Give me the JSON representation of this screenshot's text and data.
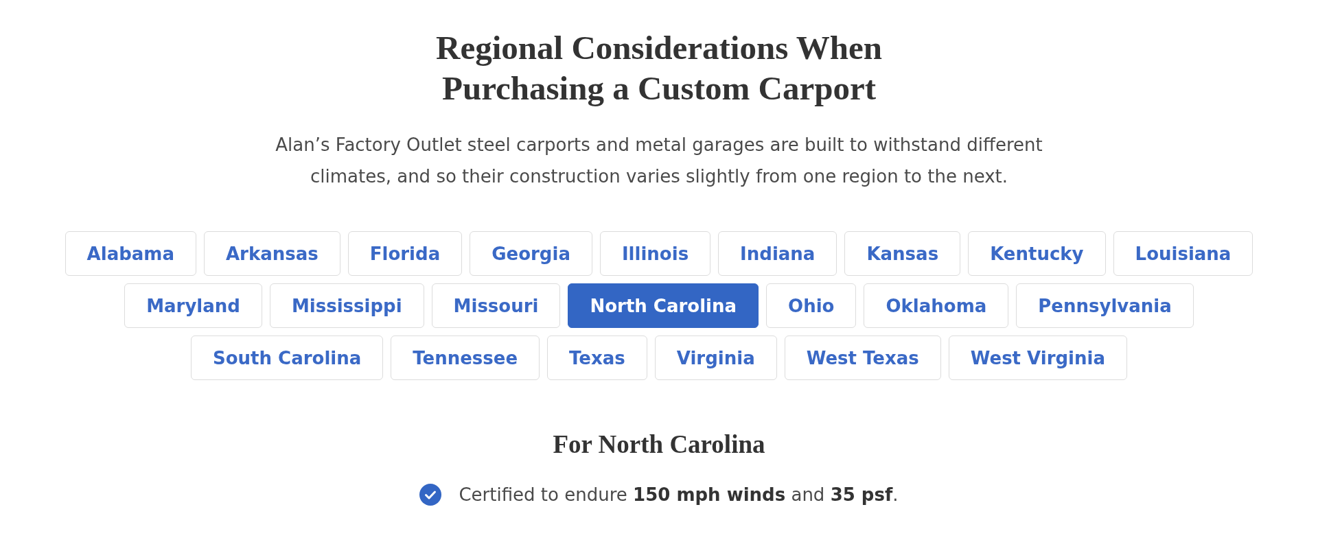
{
  "heading": {
    "title": "Regional Considerations When Purchasing a Custom Carport",
    "intro": "Alan’s Factory Outlet steel carports and metal garages are built to withstand different climates, and so their construction varies slightly from one region to the next."
  },
  "region_tabs": [
    {
      "label": "Alabama",
      "selected": false
    },
    {
      "label": "Arkansas",
      "selected": false
    },
    {
      "label": "Florida",
      "selected": false
    },
    {
      "label": "Georgia",
      "selected": false
    },
    {
      "label": "Illinois",
      "selected": false
    },
    {
      "label": "Indiana",
      "selected": false
    },
    {
      "label": "Kansas",
      "selected": false
    },
    {
      "label": "Kentucky",
      "selected": false
    },
    {
      "label": "Louisiana",
      "selected": false
    },
    {
      "label": "Maryland",
      "selected": false
    },
    {
      "label": "Mississippi",
      "selected": false
    },
    {
      "label": "Missouri",
      "selected": false
    },
    {
      "label": "North Carolina",
      "selected": true
    },
    {
      "label": "Ohio",
      "selected": false
    },
    {
      "label": "Oklahoma",
      "selected": false
    },
    {
      "label": "Pennsylvania",
      "selected": false
    },
    {
      "label": "South Carolina",
      "selected": false
    },
    {
      "label": "Tennessee",
      "selected": false
    },
    {
      "label": "Texas",
      "selected": false
    },
    {
      "label": "Virginia",
      "selected": false
    },
    {
      "label": "West Texas",
      "selected": false
    },
    {
      "label": "West Virginia",
      "selected": false
    }
  ],
  "details": {
    "title": "For North Carolina",
    "features": [
      {
        "text": "Certified to endure **150 mph winds** and **35 psf**."
      }
    ]
  }
}
